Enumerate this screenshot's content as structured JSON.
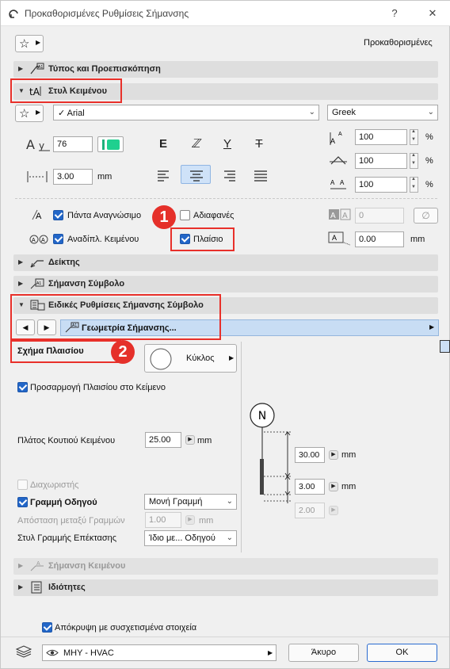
{
  "title": "Προκαθορισμένες Ρυθμίσεις Σήμανσης",
  "titlebar": {
    "help": "?",
    "close": "✕"
  },
  "favorites": {
    "value": "Προκαθορισμένες"
  },
  "sections": {
    "type_preview": "Τύπος και Προεπισκόπηση",
    "text_style": "Στυλ Κειμένου",
    "pointer": "Δείκτης",
    "symbol_label": "Σήμανση Σύμβολο",
    "special_settings": "Ειδικές Ρυθμίσεις Σήμανσης Σύμβολο",
    "text_label": "Σήμανση Κειμένου",
    "properties": "Ιδιότητες"
  },
  "text_style": {
    "font": "Arial",
    "script": "Greek",
    "size": "76",
    "font_icons": [
      "E",
      "ℤ",
      "Y",
      "T"
    ],
    "width": "3.00",
    "width_unit": "mm",
    "scale_values": [
      "100",
      "100",
      "100"
    ],
    "percent": "%"
  },
  "options": {
    "always_readable": "Πάντα Αναγνώσιμο",
    "opaque": "Αδιαφανές",
    "wrap_text": "Αναδίπλ. Κειμένου",
    "frame": "Πλαίσιο",
    "opacity_value": "0",
    "offset_value": "0.00",
    "offset_unit": "mm"
  },
  "nav": {
    "page": "Γεωμετρία Σήμανσης..."
  },
  "geometry": {
    "frame_shape_label": "Σχήμα Πλαισίου",
    "frame_shape_value": "Κύκλος",
    "fit_frame": "Προσαρμογή Πλαισίου στο Κείμενο",
    "box_width_label": "Πλάτος Κουτιού Κειμένου",
    "box_width_value": "25.00",
    "unit": "mm",
    "separator": "Διαχωριστής",
    "leader_line": "Γραμμή Οδηγού",
    "leader_type": "Μονή Γραμμή",
    "line_spacing_label": "Απόσταση μεταξύ Γραμμών",
    "line_spacing_value": "1.00",
    "ext_line_style_label": "Στυλ Γραμμής Επέκτασης",
    "ext_line_style_value": "Ίδιο με... Οδηγού",
    "preview_letter": "N",
    "dim1": "30.00",
    "dim2": "3.00",
    "dim3": "2.00"
  },
  "badges": [
    "1",
    "2"
  ],
  "hide_related": "Απόκρυψη με συσχετισμένα στοιχεία",
  "footer": {
    "layer": "ΜΗΥ - HVAC",
    "cancel": "Άκυρο",
    "ok": "OK"
  }
}
